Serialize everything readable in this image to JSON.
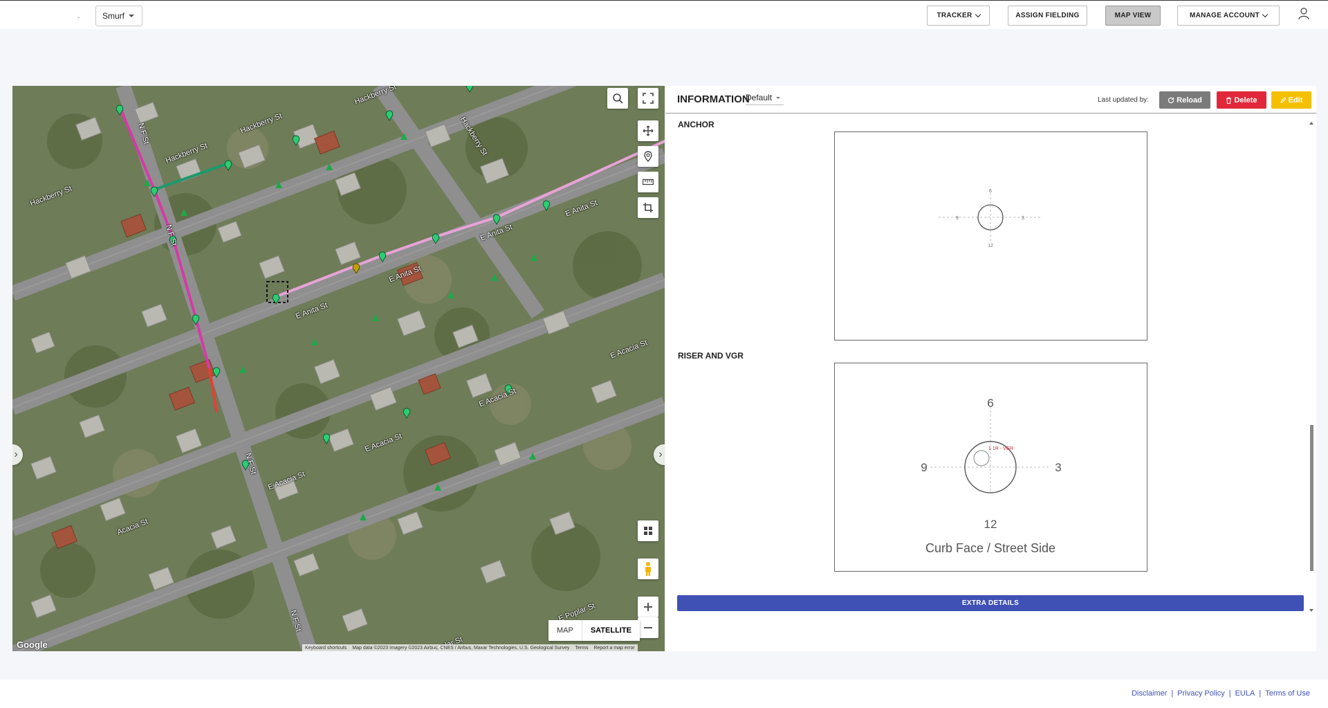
{
  "topbar": {
    "project": "Smurf",
    "nav": {
      "tracker": "TRACKER",
      "assign_fielding": "ASSIGN FIELDING",
      "map_view": "MAP VIEW",
      "manage_account": "MANAGE ACCOUNT"
    }
  },
  "map": {
    "streets": {
      "hackberry_1": "Hackberry St",
      "hackberry_2": "Hackberry St",
      "hackberry_3": "Hackberry St",
      "hackberry_4": "Hackberry St",
      "hackberry_5": "Hackberry St",
      "nf_1": "N F St",
      "nf_2": "N F St",
      "nf_3": "N F St",
      "nf_4": "N F St",
      "anita_1": "E Anita St",
      "anita_2": "E Anita St",
      "anita_3": "E Anita St",
      "anita_4": "E Anita St",
      "acacia_1": "E Acacia St",
      "acacia_2": "E Acacia St",
      "acacia_3": "E Acacia St",
      "acacia_4": "E Acacia St",
      "acacia_5": "Acacia St",
      "poplar_1": "E Poplar St",
      "poplar_2": "Poplar St"
    },
    "map_type": {
      "map": "MAP",
      "satellite": "SATELLITE",
      "selected": "SATELLITE"
    },
    "google": "Google",
    "attribution": {
      "shortcuts": "Keyboard shortcuts",
      "data": "Map data ©2023 Imagery ©2023 Airbus, CNES / Airbus, Maxar Technologies, U.S. Geological Survey",
      "terms": "Terms",
      "report": "Report a map error"
    }
  },
  "panel": {
    "title": "INFORMATION",
    "view": "Default",
    "last_updated": "Last updated by:",
    "buttons": {
      "reload": "Reload",
      "delete": "Delete",
      "edit": "Edit"
    },
    "anchor": {
      "label": "ANCHOR",
      "dial": {
        "top": "6",
        "bottom": "12",
        "left": "9",
        "right": "3"
      }
    },
    "riser": {
      "label": "RISER AND VGR",
      "dial": {
        "top": "6",
        "bottom": "12",
        "left": "9",
        "right": "3"
      },
      "marker": "1 1R - VGR",
      "caption": "Curb Face / Street Side"
    },
    "extra_details": "EXTRA DETAILS"
  },
  "footer": {
    "disclaimer": "Disclaimer",
    "privacy": "Privacy Policy",
    "eula": "EULA",
    "terms": "Terms of Use"
  },
  "colors": {
    "accent": "#3f51b5",
    "reload": "#7b7b7b",
    "delete": "#e0283a",
    "edit": "#f5c000",
    "pin": "#2ecc71",
    "route_magenta": "#d63aa6",
    "route_pink": "#e6a3d6",
    "route_green": "#1c9a6c",
    "route_red": "#e2403a"
  }
}
